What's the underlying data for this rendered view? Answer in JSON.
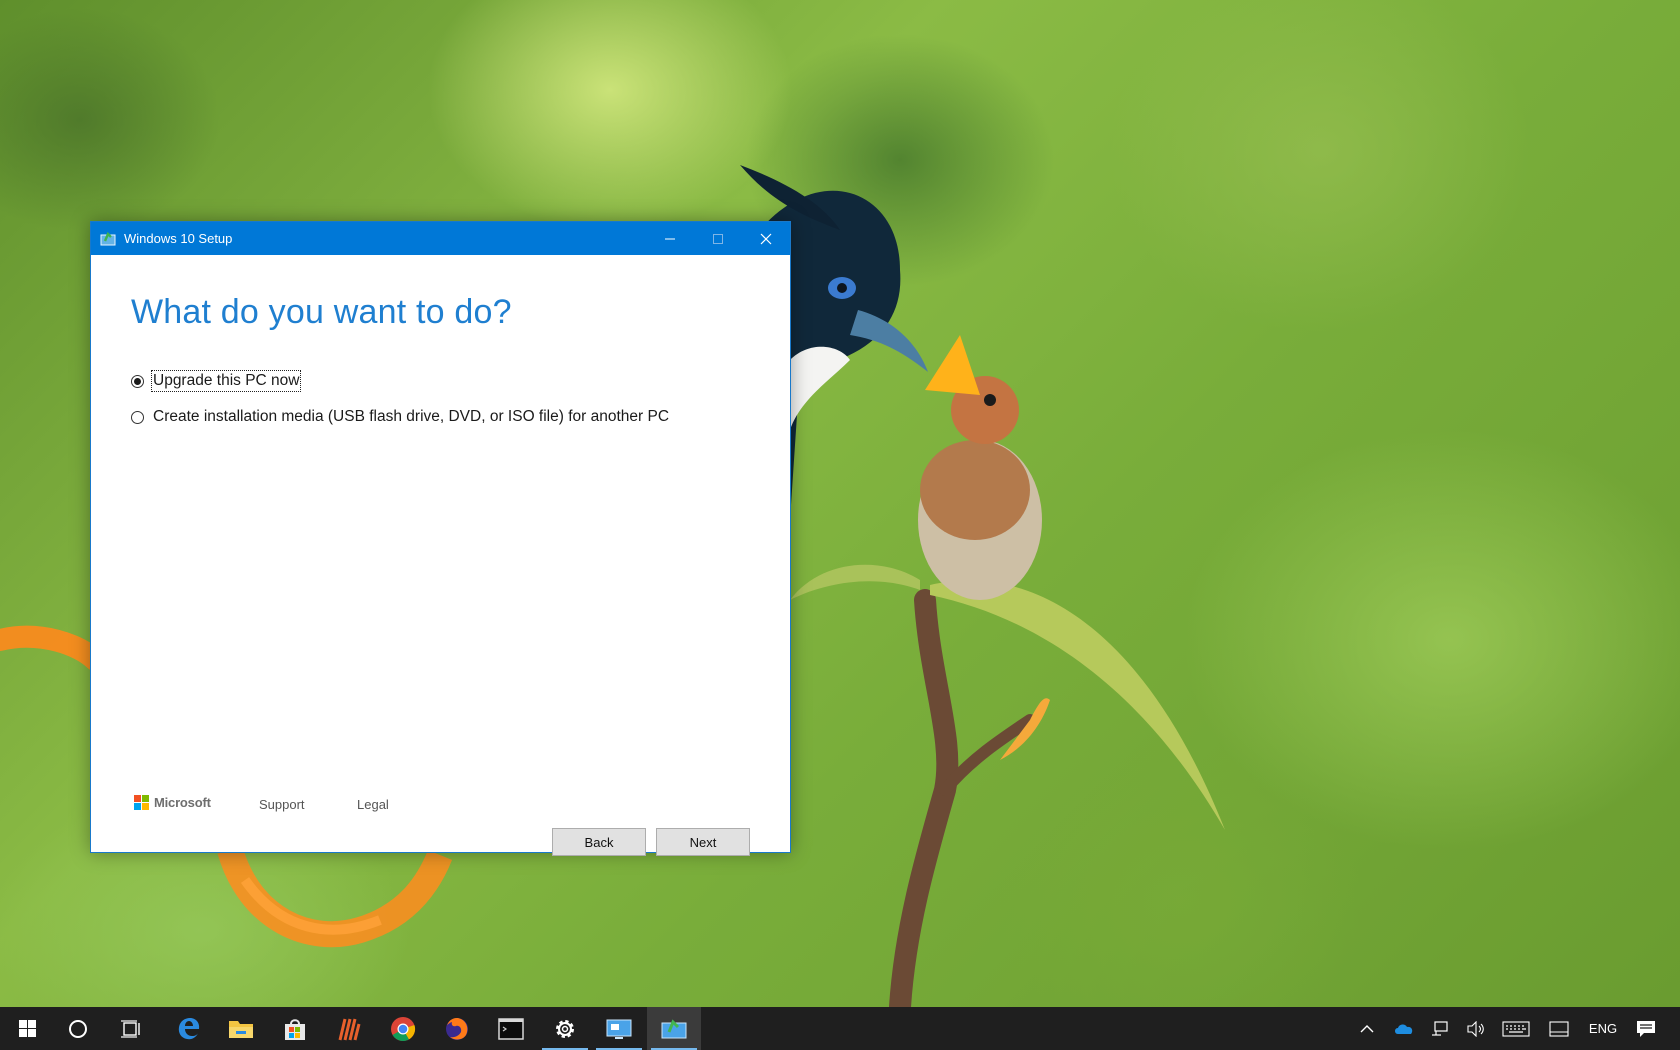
{
  "window": {
    "title": "Windows 10 Setup",
    "heading": "What do you want to do?",
    "options": [
      {
        "label": "Upgrade this PC now",
        "selected": true
      },
      {
        "label": "Create installation media (USB flash drive, DVD, or ISO file) for another PC",
        "selected": false
      }
    ],
    "footer": {
      "brand": "Microsoft",
      "support_label": "Support",
      "legal_label": "Legal"
    },
    "buttons": {
      "back_label": "Back",
      "next_label": "Next"
    },
    "accent_color": "#0078d7"
  },
  "taskbar": {
    "pinned": [
      {
        "icon": "windows-start-icon"
      },
      {
        "icon": "cortana-search-icon"
      },
      {
        "icon": "task-view-icon"
      },
      {
        "icon": "edge-icon"
      },
      {
        "icon": "file-explorer-icon"
      },
      {
        "icon": "store-icon"
      },
      {
        "icon": "app-icon"
      },
      {
        "icon": "chrome-icon"
      },
      {
        "icon": "firefox-icon"
      },
      {
        "icon": "terminal-icon"
      },
      {
        "icon": "settings-gear-icon"
      },
      {
        "icon": "remote-desktop-icon"
      },
      {
        "icon": "windows-setup-icon"
      }
    ],
    "tray": {
      "language": "ENG"
    }
  }
}
